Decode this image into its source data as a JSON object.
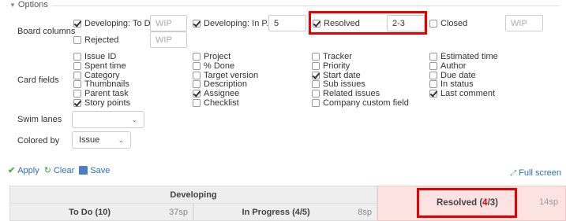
{
  "legend": "Options",
  "board_columns": {
    "label": "Board columns",
    "items": [
      {
        "label": "Developing: To Do",
        "checked": true,
        "value": "",
        "placeholder": "WIP"
      },
      {
        "label": "Developing: In P...",
        "checked": true,
        "value": "5",
        "placeholder": "WIP"
      },
      {
        "label": "Resolved",
        "checked": true,
        "value": "2-3",
        "placeholder": "WIP"
      },
      {
        "label": "Closed",
        "checked": false,
        "value": "",
        "placeholder": "WIP"
      },
      {
        "label": "Rejected",
        "checked": false,
        "value": "",
        "placeholder": "WIP"
      }
    ]
  },
  "card_fields": {
    "label": "Card fields",
    "items": [
      {
        "label": "Issue ID",
        "checked": false
      },
      {
        "label": "Spent time",
        "checked": false
      },
      {
        "label": "Category",
        "checked": false
      },
      {
        "label": "Thumbnails",
        "checked": false
      },
      {
        "label": "Parent task",
        "checked": false
      },
      {
        "label": "Story points",
        "checked": true
      },
      {
        "label": "Project",
        "checked": false
      },
      {
        "label": "% Done",
        "checked": false
      },
      {
        "label": "Target version",
        "checked": false
      },
      {
        "label": "Description",
        "checked": false
      },
      {
        "label": "Assignee",
        "checked": true
      },
      {
        "label": "Checklist",
        "checked": false
      },
      {
        "label": "Tracker",
        "checked": false
      },
      {
        "label": "Priority",
        "checked": false
      },
      {
        "label": "Start date",
        "checked": true
      },
      {
        "label": "Sub issues",
        "checked": false
      },
      {
        "label": "Related issues",
        "checked": false
      },
      {
        "label": "Company custom field",
        "checked": false
      },
      {
        "label": "Estimated time",
        "checked": false
      },
      {
        "label": "Author",
        "checked": false
      },
      {
        "label": "Due date",
        "checked": false
      },
      {
        "label": "In status",
        "checked": false
      },
      {
        "label": "Last comment",
        "checked": true
      }
    ]
  },
  "swim_lanes": {
    "label": "Swim lanes",
    "value": ""
  },
  "colored_by": {
    "label": "Colored by",
    "value": "Issue"
  },
  "actions": {
    "apply": "Apply",
    "clear": "Clear",
    "save": "Save"
  },
  "full_screen": "Full screen",
  "board": {
    "group": "Developing",
    "todo": {
      "name": "To Do (10)",
      "sp": "37sp"
    },
    "in_progress": {
      "name": "In Progress (4/5)",
      "sp": "8sp"
    },
    "resolved": {
      "name_prefix": "Resolved (",
      "count": "4",
      "name_suffix": "/3)",
      "sp": "14sp",
      "alert_color": "#e60000"
    }
  },
  "colors": {
    "link": "#2a6fb8",
    "highlight": "#e60000",
    "resolved_bg": "#fde2e2"
  }
}
